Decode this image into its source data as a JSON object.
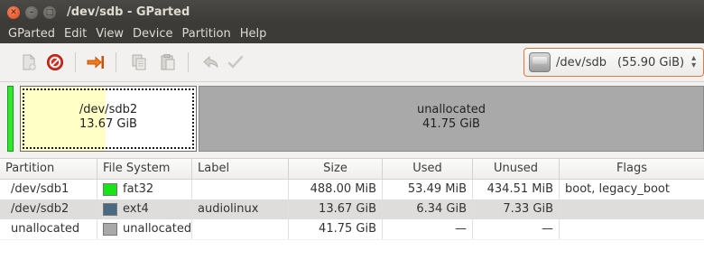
{
  "window": {
    "title": "/dev/sdb - GParted"
  },
  "menu": [
    "GParted",
    "Edit",
    "View",
    "Device",
    "Partition",
    "Help"
  ],
  "toolbar": {
    "buttons": [
      "new-icon",
      "delete-icon",
      "resize-move-icon",
      "copy-icon",
      "paste-icon",
      "undo-icon",
      "apply-icon"
    ]
  },
  "device": {
    "name": "/dev/sdb",
    "size": "(55.90 GiB)"
  },
  "diskmap": {
    "sdb2": {
      "name": "/dev/sdb2",
      "size": "13.67 GiB"
    },
    "unallocated": {
      "name": "unallocated",
      "size": "41.75 GiB"
    }
  },
  "table": {
    "headers": [
      "Partition",
      "File System",
      "Label",
      "Size",
      "Used",
      "Unused",
      "Flags"
    ],
    "rows": [
      {
        "partition": "/dev/sdb1",
        "fs": "fat32",
        "fs_color": "#18e518",
        "label": "",
        "size": "488.00 MiB",
        "used": "53.49 MiB",
        "unused": "434.51 MiB",
        "flags": "boot, legacy_boot"
      },
      {
        "partition": "/dev/sdb2",
        "fs": "ext4",
        "fs_color": "#4b6983",
        "label": "audiolinux",
        "size": "13.67 GiB",
        "used": "6.34 GiB",
        "unused": "7.33 GiB",
        "flags": ""
      },
      {
        "partition": "unallocated",
        "fs": "unallocated",
        "fs_color": "#a9a9a9",
        "label": "",
        "size": "41.75 GiB",
        "used": "—",
        "unused": "—",
        "flags": ""
      }
    ]
  }
}
